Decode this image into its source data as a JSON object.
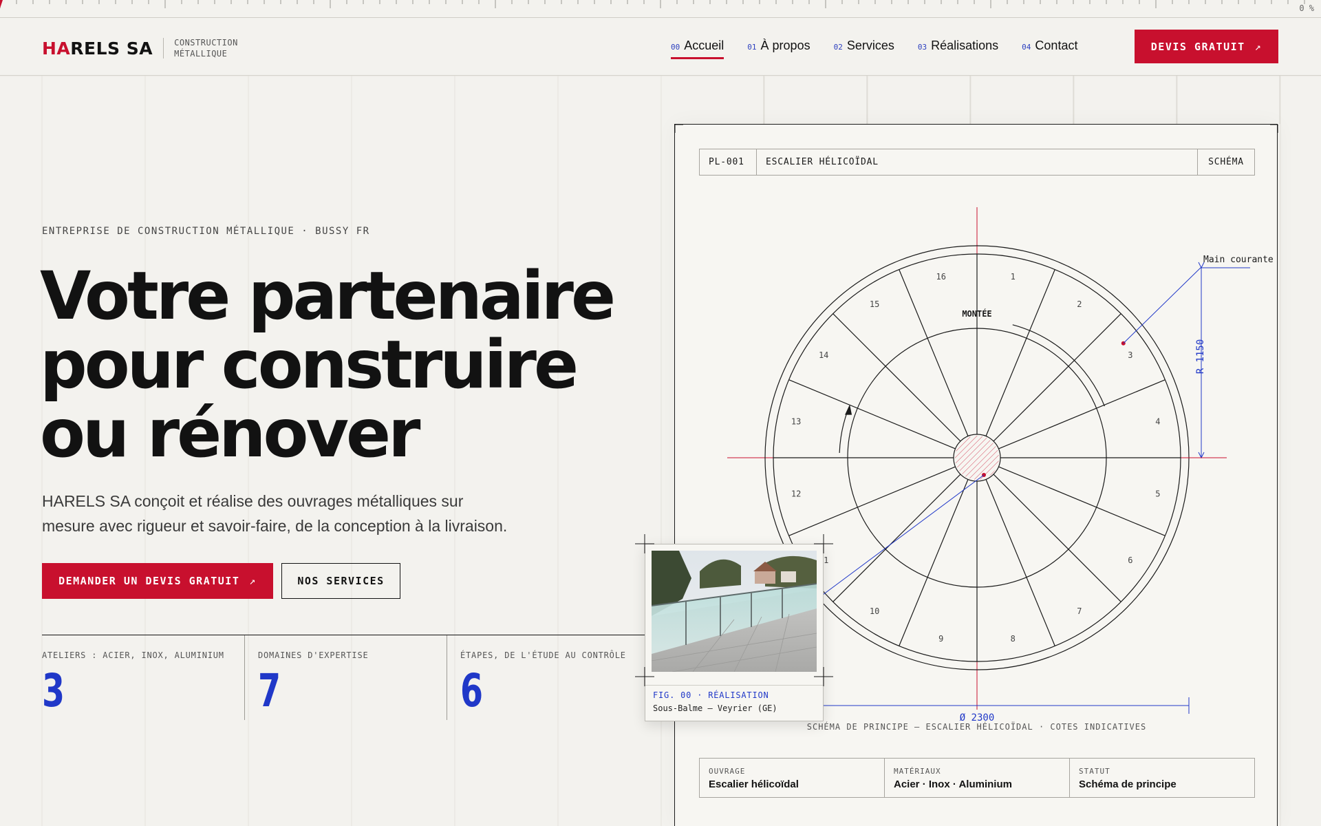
{
  "ruler": {
    "progress_label": "0 %"
  },
  "header": {
    "logo": {
      "part1": "HA",
      "part2": "R",
      "part3": "ELS SA",
      "sub_line1": "CONSTRUCTION",
      "sub_line2": "MÉTALLIQUE"
    },
    "nav": [
      {
        "num": "00",
        "label": "Accueil",
        "active": true
      },
      {
        "num": "01",
        "label": "À propos"
      },
      {
        "num": "02",
        "label": "Services"
      },
      {
        "num": "03",
        "label": "Réalisations"
      },
      {
        "num": "04",
        "label": "Contact"
      }
    ],
    "cta": {
      "label": "DEVIS GRATUIT",
      "arrow": "↗"
    }
  },
  "hero": {
    "eyebrow": "ENTREPRISE DE CONSTRUCTION MÉTALLIQUE · BUSSY FR",
    "title_lines": [
      "Votre partenaire",
      "pour construire",
      "ou rénover"
    ],
    "lead_line1": "HARELS SA conçoit et réalise des ouvrages métalliques sur",
    "lead_line2": "mesure avec rigueur et savoir-faire, de la conception à la livraison.",
    "primary_button": "DEMANDER UN DEVIS GRATUIT",
    "primary_arrow": "↗",
    "secondary_button": "NOS SERVICES"
  },
  "stats": [
    {
      "label": "ATELIERS : ACIER, INOX, ALUMINIUM",
      "value": "3"
    },
    {
      "label": "DOMAINES D'EXPERTISE",
      "value": "7"
    },
    {
      "label": "ÉTAPES, DE L'ÉTUDE AU CONTRÔLE",
      "value": "6"
    }
  ],
  "drawing": {
    "code": "PL-001",
    "title": "ESCALIER HÉLICOÏDAL",
    "tag": "SCHÉMA",
    "step_labels": [
      "1",
      "2",
      "3",
      "4",
      "5",
      "6",
      "7",
      "8",
      "9",
      "10",
      "11",
      "12",
      "13",
      "14",
      "15",
      "16"
    ],
    "montee_label": "MONTÉE",
    "handrail_label": "Main courante",
    "radius_label": "R 1150",
    "diameter_label": "Ø 2300",
    "caption": "SCHÉMA DE PRINCIPE — ESCALIER HÉLICOÏDAL · COTES INDICATIVES",
    "specs": [
      {
        "label": "OUVRAGE",
        "value": "Escalier hélicoïdal"
      },
      {
        "label": "MATÉRIAUX",
        "value": "Acier · Inox · Aluminium"
      },
      {
        "label": "STATUT",
        "value": "Schéma de principe"
      }
    ],
    "accent_red": "#c8102e",
    "accent_blue": "#2038c8"
  },
  "photo": {
    "tag": "FIG. 00 · RÉALISATION",
    "location": "Sous-Balme — Veyrier (GE)"
  }
}
